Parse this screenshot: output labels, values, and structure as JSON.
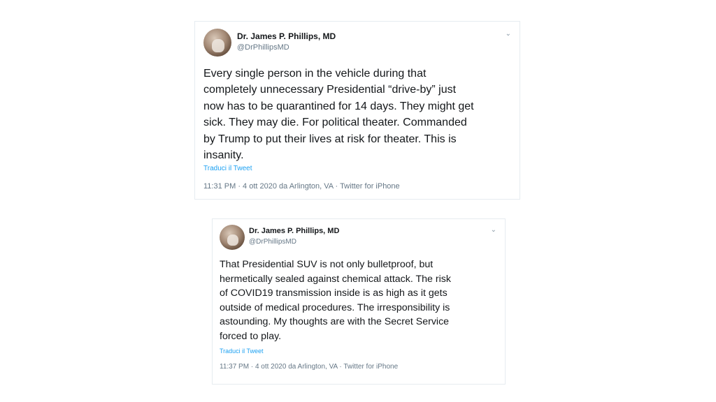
{
  "tweets": [
    {
      "author_name": "Dr. James P. Phillips, MD",
      "author_handle": "@DrPhillipsMD",
      "avatar_icon": "profile-photo",
      "menu_icon": "chevron-down-icon",
      "menu_glyph": "⌄",
      "text": "Every single person in the vehicle during that\ncompletely unnecessary Presidential “drive-by” just\nnow has to be quarantined for 14 days. They might get\nsick. They may die. For political theater. Commanded\nby Trump to put their lives at risk for theater. This is\ninsanity.",
      "translate_link": "Traduci il Tweet",
      "meta": "11:31 PM · 4 ott 2020 da Arlington, VA · Twitter for iPhone"
    },
    {
      "author_name": "Dr. James P. Phillips, MD",
      "author_handle": "@DrPhillipsMD",
      "avatar_icon": "profile-photo",
      "menu_icon": "chevron-down-icon",
      "menu_glyph": "⌄",
      "text": "That Presidential SUV is not only bulletproof, but\nhermetically sealed against chemical attack. The risk\nof COVID19 transmission inside is as high as it gets\noutside of medical procedures. The irresponsibility is\nastounding. My thoughts are with the Secret Service\nforced to play.",
      "translate_link": "Traduci il Tweet",
      "meta": "11:37 PM · 4 ott 2020 da Arlington, VA · Twitter for iPhone"
    }
  ],
  "colors": {
    "text": "#14171a",
    "secondary": "#657786",
    "link": "#1da1f2",
    "border": "#e6ecf0"
  }
}
